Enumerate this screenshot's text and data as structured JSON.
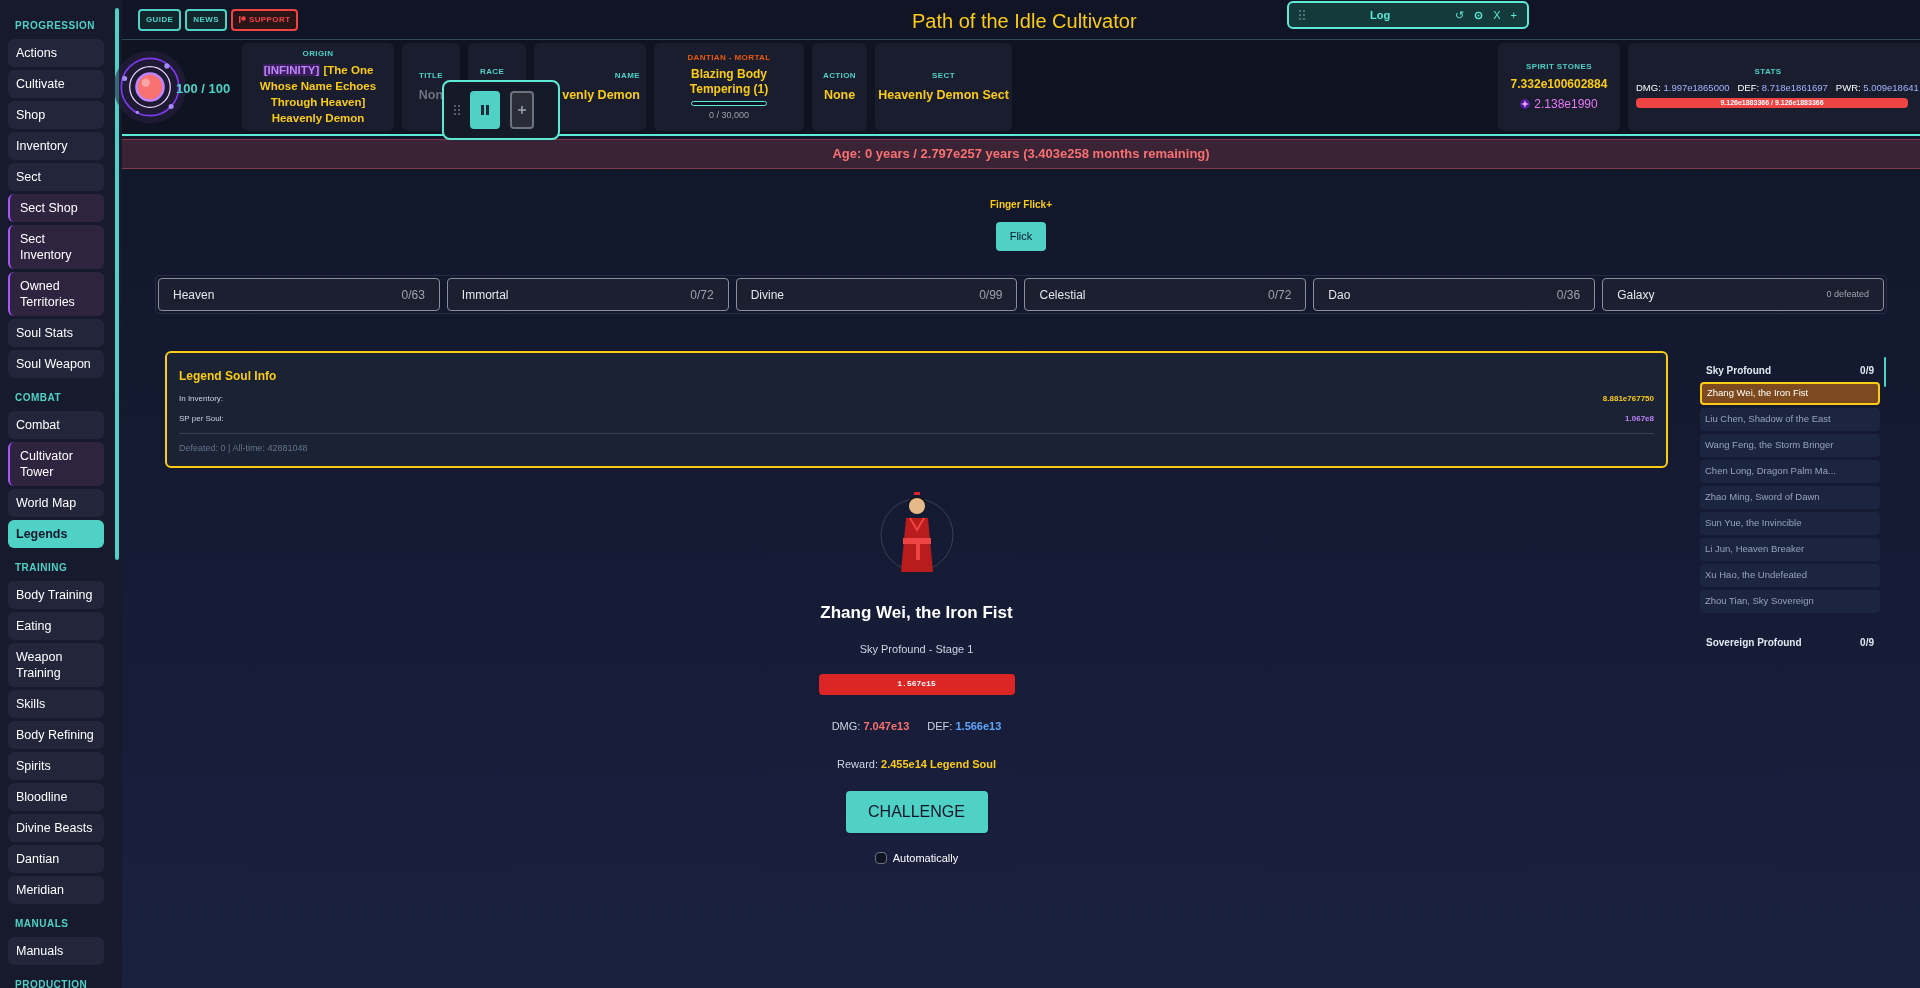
{
  "sidebar": {
    "sections": [
      {
        "title": "PROGRESSION",
        "items": [
          {
            "label": "Actions",
            "accent": false,
            "selected": false
          },
          {
            "label": "Cultivate",
            "accent": false,
            "selected": false
          },
          {
            "label": "Shop",
            "accent": false,
            "selected": false
          },
          {
            "label": "Inventory",
            "accent": false,
            "selected": false
          },
          {
            "label": "Sect",
            "accent": false,
            "selected": false
          },
          {
            "label": "Sect Shop",
            "accent": true,
            "selected": false
          },
          {
            "label": "Sect Inventory",
            "accent": true,
            "selected": false
          },
          {
            "label": "Owned Territories",
            "accent": true,
            "selected": false
          },
          {
            "label": "Soul Stats",
            "accent": false,
            "selected": false
          },
          {
            "label": "Soul Weapon",
            "accent": false,
            "selected": false
          }
        ]
      },
      {
        "title": "COMBAT",
        "items": [
          {
            "label": "Combat",
            "accent": false,
            "selected": false
          },
          {
            "label": "Cultivator Tower",
            "accent": true,
            "selected": false
          },
          {
            "label": "World Map",
            "accent": false,
            "selected": false
          },
          {
            "label": "Legends",
            "accent": false,
            "selected": true
          }
        ]
      },
      {
        "title": "TRAINING",
        "items": [
          {
            "label": "Body Training",
            "accent": false,
            "selected": false
          },
          {
            "label": "Eating",
            "accent": false,
            "selected": false
          },
          {
            "label": "Weapon Training",
            "accent": false,
            "selected": false
          },
          {
            "label": "Skills",
            "accent": false,
            "selected": false
          },
          {
            "label": "Body Refining",
            "accent": false,
            "selected": false
          },
          {
            "label": "Spirits",
            "accent": false,
            "selected": false
          },
          {
            "label": "Bloodline",
            "accent": false,
            "selected": false
          },
          {
            "label": "Divine Beasts",
            "accent": false,
            "selected": false
          },
          {
            "label": "Dantian",
            "accent": false,
            "selected": false
          },
          {
            "label": "Meridian",
            "accent": false,
            "selected": false
          }
        ]
      },
      {
        "title": "MANUALS",
        "items": [
          {
            "label": "Manuals",
            "accent": false,
            "selected": false
          }
        ]
      },
      {
        "title": "PRODUCTION"
      }
    ]
  },
  "top_bar": {
    "buttons": [
      {
        "label": "GUIDE",
        "kind": "teal"
      },
      {
        "label": "NEWS",
        "kind": "teal"
      },
      {
        "label": "SUPPORT",
        "kind": "red"
      }
    ],
    "title": "Path of the Idle Cultivator"
  },
  "log_panel": {
    "title": "Log",
    "controls": [
      {
        "kind": "text",
        "label": "↺"
      },
      {
        "kind": "gear"
      },
      {
        "kind": "text",
        "label": "X"
      },
      {
        "kind": "text",
        "label": "+"
      }
    ]
  },
  "header": {
    "orb": {
      "reading": "100 / 100"
    },
    "cards": [
      {
        "kind": "origin",
        "label": "ORIGIN",
        "badge": "[INFINITY]",
        "value": "[The One Whose Name Echoes Through Heaven] Heavenly Demon"
      },
      {
        "kind": "plain",
        "label": "TITLE",
        "value": "Non",
        "muted": true
      },
      {
        "kind": "plain",
        "label": "RACE"
      },
      {
        "kind": "plain",
        "label": "NAME",
        "value": "venly Demon",
        "muted": false
      },
      {
        "kind": "progress",
        "label": "DANTIAN - MORTAL",
        "value": "Blazing Body Tempering (1)",
        "level": 0,
        "reading": "0 / 30,000"
      },
      {
        "kind": "plain",
        "label": "ACTION",
        "value": "None",
        "muted": false
      },
      {
        "kind": "plain",
        "label": "SECT",
        "value": "Heavenly Demon Sect",
        "muted": false
      }
    ],
    "spirit_stones": {
      "label": "SPIRIT STONES",
      "value": "7.332e100602884",
      "secondary": "2.138e1990"
    },
    "stats": {
      "label": "STATS",
      "items": [
        {
          "name": "DMG:",
          "value": "1.997e1865000"
        },
        {
          "name": "DEF:",
          "value": "8.718e1861697"
        },
        {
          "name": "PWR:",
          "value": "5.009e18641"
        }
      ],
      "bar": {
        "level": 1,
        "reading": "9.126e1883366 / 9.126e1883366"
      }
    }
  },
  "age_bar": "Age: 0 years / 2.797e257 years (3.403e258 months remaining)",
  "skill": {
    "name": "Finger Flick+",
    "button": "Flick"
  },
  "realm_tabs": [
    {
      "label": "Heaven",
      "count": "0/63",
      "selected": false
    },
    {
      "label": "Immortal",
      "count": "0/72",
      "selected": false
    },
    {
      "label": "Divine",
      "count": "0/99",
      "selected": false
    },
    {
      "label": "Celestial",
      "count": "0/72",
      "selected": false
    },
    {
      "label": "Dao",
      "count": "0/36",
      "selected": false
    },
    {
      "label": "Galaxy",
      "count": "0 defeated",
      "selected": false
    }
  ],
  "legend_info": {
    "title": "Legend Soul Info",
    "rows": [
      {
        "label": "In Inventory:",
        "value": "8.881e767750",
        "kind": "inventory"
      },
      {
        "label": "SP per Soul:",
        "value": "1.067e8",
        "kind": "rate"
      }
    ],
    "footer": "Defeated: 0 | All-time: 42881048"
  },
  "opponent": {
    "name": "Zhang Wei, the Iron Fist",
    "subtitle": "Sky Profound - Stage 1",
    "hp": {
      "level": 1,
      "reading": "1.567e15"
    },
    "dmg_label": "DMG:",
    "dmg": "7.047e13",
    "def_label": "DEF:",
    "def": "1.566e13",
    "reward_label": "Reward:",
    "reward": "2.455e14 Legend Soul",
    "button": "CHALLENGE",
    "auto": {
      "label": "Automatically",
      "checked": false
    }
  },
  "legend_list": [
    {
      "name": "Sky Profound",
      "count": "0/9",
      "items": [
        {
          "name": "Zhang Wei, the Iron Fist",
          "selected": true
        },
        {
          "name": "Liu Chen, Shadow of the East",
          "selected": false
        },
        {
          "name": "Wang Feng, the Storm Bringer",
          "selected": false
        },
        {
          "name": "Chen Long, Dragon Palm Ma...",
          "selected": false
        },
        {
          "name": "Zhao Ming, Sword of Dawn",
          "selected": false
        },
        {
          "name": "Sun Yue, the Invincible",
          "selected": false
        },
        {
          "name": "Li Jun, Heaven Breaker",
          "selected": false
        },
        {
          "name": "Xu Hao, the Undefeated",
          "selected": false
        },
        {
          "name": "Zhou Tian, Sky Sovereign",
          "selected": false
        }
      ]
    },
    {
      "name": "Sovereign Profound",
      "count": "0/9"
    }
  ]
}
